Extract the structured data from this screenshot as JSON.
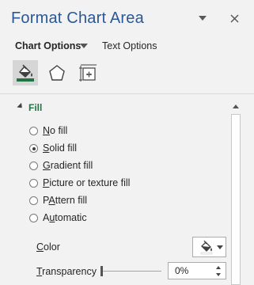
{
  "pane": {
    "title": "Format Chart Area"
  },
  "tabs": {
    "chart_options": "Chart Options",
    "text_options": "Text Options"
  },
  "icon_tabs": [
    {
      "name": "fill-line-icon",
      "active": true
    },
    {
      "name": "effects-icon",
      "active": false
    },
    {
      "name": "size-properties-icon",
      "active": false
    }
  ],
  "fill": {
    "header": "Fill",
    "options": [
      {
        "key": "N",
        "rest": "o fill",
        "selected": false
      },
      {
        "key": "S",
        "rest": "olid fill",
        "selected": true
      },
      {
        "key": "G",
        "rest": "radient fill",
        "selected": false
      },
      {
        "key": "P",
        "rest": "icture or texture fill",
        "selected": false
      },
      {
        "key": "A",
        "rest": "ttern fill",
        "prefix": "P",
        "selected": false
      },
      {
        "key": "u",
        "rest": "tomatic",
        "prefix": "A",
        "selected": false
      }
    ],
    "color_label_key": "C",
    "color_label_rest": "olor",
    "transparency_label_key": "T",
    "transparency_label_rest": "ransparency",
    "transparency_value": "0%"
  }
}
